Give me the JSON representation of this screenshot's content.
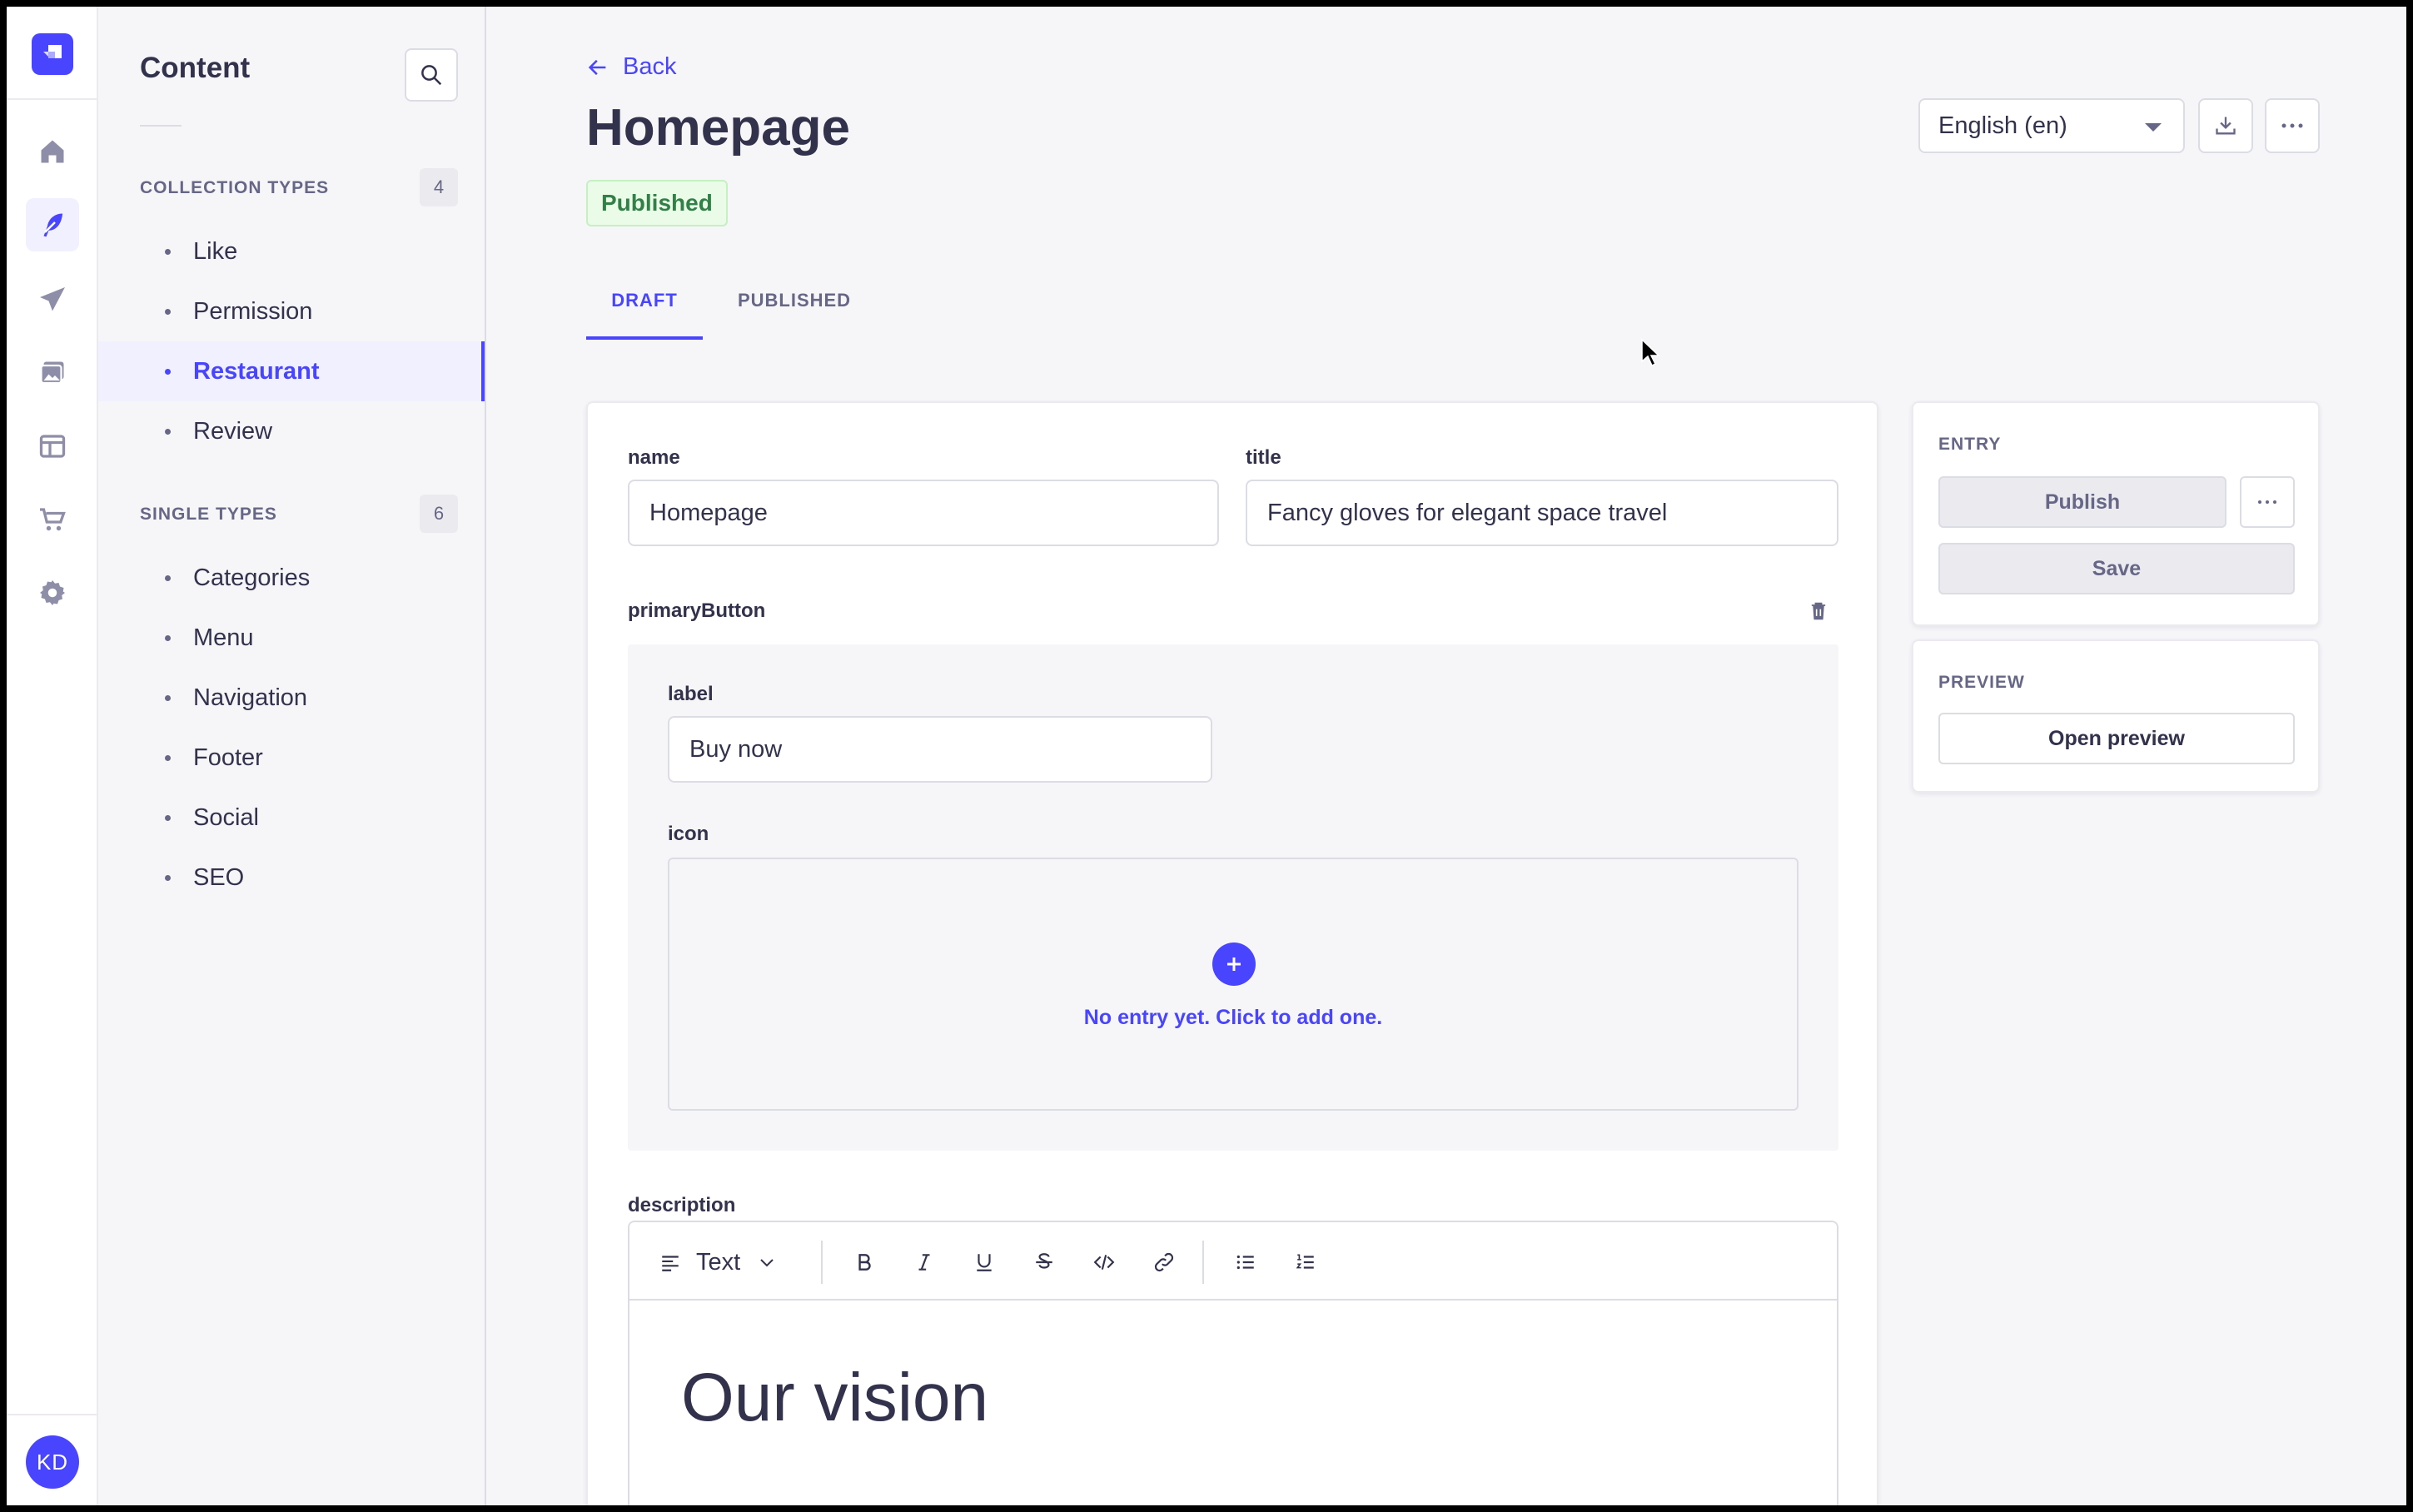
{
  "rail": {
    "avatar_initials": "KD",
    "icons": [
      "house-icon",
      "feather-icon",
      "paper-plane-icon",
      "media-library-icon",
      "layout-icon",
      "cart-icon",
      "gear-icon"
    ]
  },
  "sidebar": {
    "title": "Content",
    "collection_types": {
      "heading": "COLLECTION TYPES",
      "count": "4",
      "items": [
        {
          "label": "Like"
        },
        {
          "label": "Permission"
        },
        {
          "label": "Restaurant",
          "active": true
        },
        {
          "label": "Review"
        }
      ]
    },
    "single_types": {
      "heading": "SINGLE TYPES",
      "count": "6",
      "items": [
        {
          "label": "Categories"
        },
        {
          "label": "Menu"
        },
        {
          "label": "Navigation"
        },
        {
          "label": "Footer"
        },
        {
          "label": "Social"
        },
        {
          "label": "SEO"
        }
      ]
    }
  },
  "header": {
    "back_label": "Back",
    "title": "Homepage",
    "status": "Published",
    "locale": "English (en)"
  },
  "tabs": [
    {
      "label": "DRAFT",
      "active": true
    },
    {
      "label": "PUBLISHED",
      "active": false
    }
  ],
  "form": {
    "name": {
      "label": "name",
      "value": "Homepage"
    },
    "title": {
      "label": "title",
      "value": "Fancy gloves for elegant space travel"
    },
    "primary_button": {
      "label": "primaryButton",
      "button_label": {
        "label": "label",
        "value": "Buy now"
      },
      "icon": {
        "label": "icon",
        "empty_text": "No entry yet. Click to add one."
      }
    },
    "description": {
      "label": "description",
      "block_type": "Text",
      "heading": "Our vision"
    }
  },
  "entry_panel": {
    "title": "ENTRY",
    "publish_label": "Publish",
    "save_label": "Save"
  },
  "preview_panel": {
    "title": "PREVIEW",
    "open_label": "Open preview"
  },
  "colors": {
    "primary": "#4945ff",
    "success_text": "#328048",
    "success_bg": "#eafbe7",
    "neutral_text": "#32324d"
  }
}
